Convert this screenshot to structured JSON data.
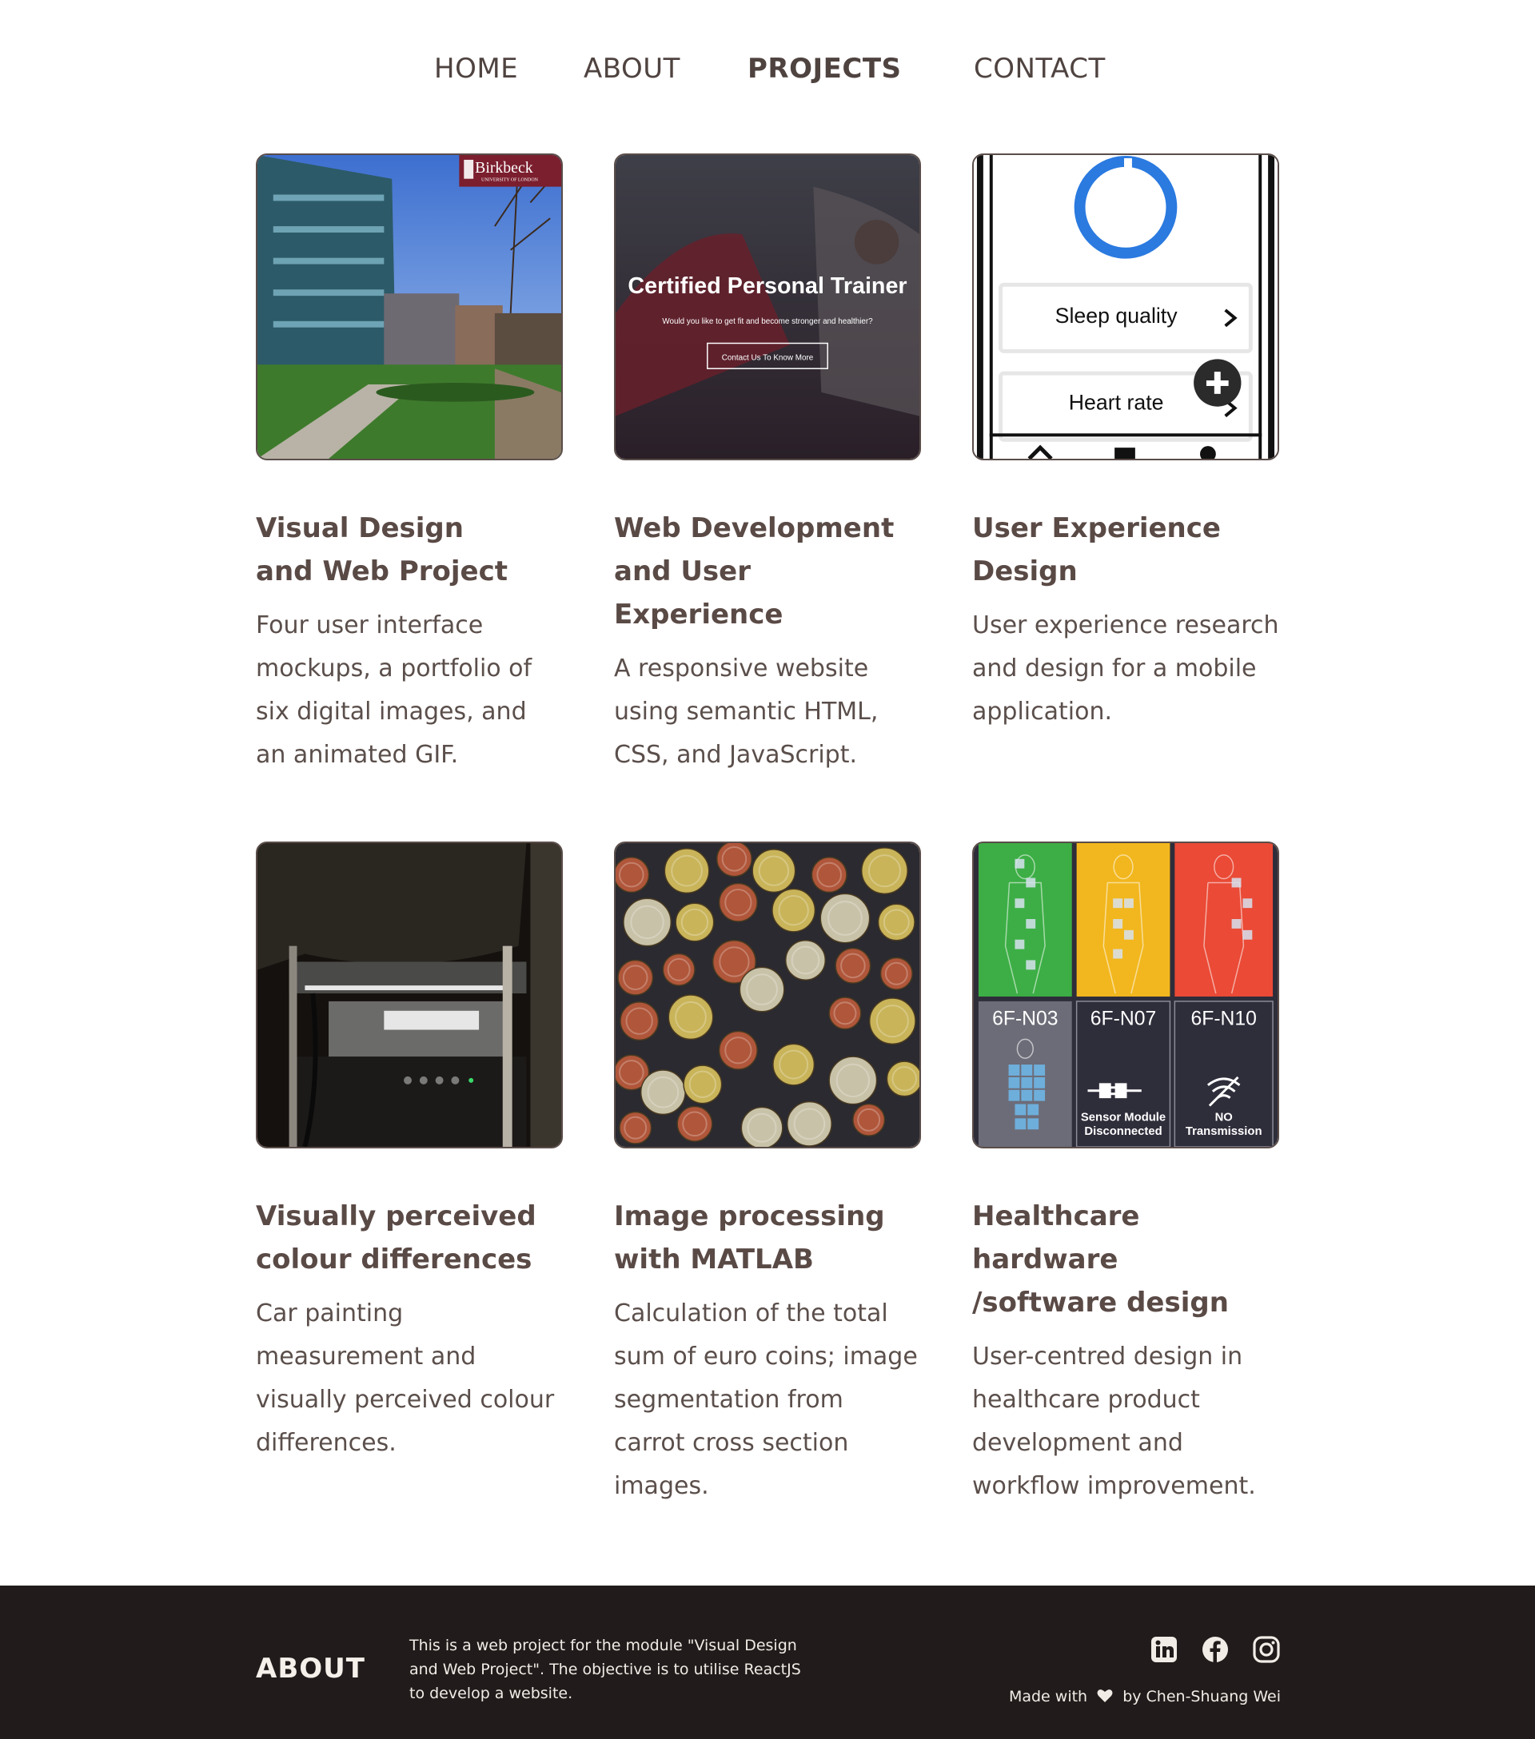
{
  "nav": {
    "items": [
      {
        "label": "HOME"
      },
      {
        "label": "ABOUT"
      },
      {
        "label": "PROJECTS"
      },
      {
        "label": "CONTACT"
      }
    ],
    "active": "PROJECTS"
  },
  "projects": [
    {
      "title_line1": "Visual Design",
      "title_line2": "and Web Project",
      "description": "Four user interface mockups, a portfolio of six digital images, and an animated GIF.",
      "image": {
        "badge_text": "Birkbeck",
        "badge_sub": "UNIVERSITY OF LONDON"
      }
    },
    {
      "title_line1": "Web Development",
      "title_line2": "and User Experience",
      "description": "A responsive website using semantic HTML, CSS, and JavaScript.",
      "image": {
        "headline": "Certified Personal Trainer",
        "subline": "Would you like to get fit and become stronger and healthier?",
        "button": "Contact Us To Know More"
      }
    },
    {
      "title_line1": "User Experience",
      "title_line2": "Design",
      "description": "User experience research and design for a mobile application.",
      "image": {
        "row1": "Sleep quality",
        "row2": "Heart rate"
      }
    },
    {
      "title_line1": "Visually perceived",
      "title_line2": "colour differences",
      "description": "Car painting measurement and visually perceived colour differences.",
      "image": {}
    },
    {
      "title_line1": "Image processing",
      "title_line2": "with MATLAB",
      "description": "Calculation of the total sum of euro coins; image segmentation from carrot cross section images.",
      "image": {}
    },
    {
      "title_line1": "Healthcare hardware",
      "title_line2": "/software design",
      "description": "User-centred design in healthcare product development and workflow improvement.",
      "image": {
        "beds": [
          "6F-N03",
          "6F-N07",
          "6F-N10"
        ],
        "status2a": "Sensor Module",
        "status2b": "Disconnected",
        "status3a": "NO",
        "status3b": "Transmission"
      }
    }
  ],
  "footer": {
    "title": "ABOUT",
    "text": "This is a web project for the module \"Visual Design and Web Project\". The objective is to utilise ReactJS to develop a website.",
    "made_prefix": "Made with",
    "made_suffix": "by Chen-Shuang Wei",
    "icons": [
      "linkedin-icon",
      "facebook-icon",
      "instagram-icon",
      "heart-icon"
    ]
  },
  "colors": {
    "text": "#4f4340",
    "footer_bg": "#211c1b",
    "footer_text": "#f1ece6"
  }
}
